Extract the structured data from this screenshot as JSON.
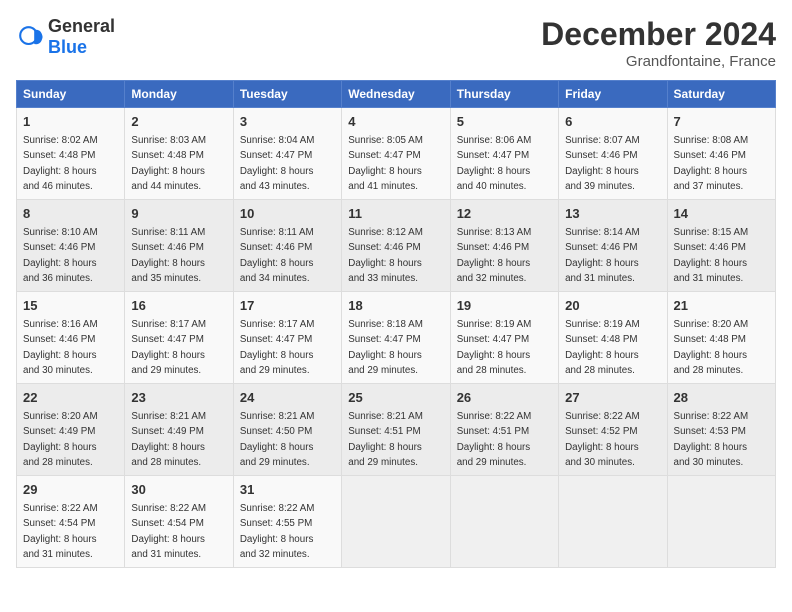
{
  "header": {
    "logo_general": "General",
    "logo_blue": "Blue",
    "month_title": "December 2024",
    "location": "Grandfontaine, France"
  },
  "days_of_week": [
    "Sunday",
    "Monday",
    "Tuesday",
    "Wednesday",
    "Thursday",
    "Friday",
    "Saturday"
  ],
  "weeks": [
    [
      {
        "day": "1",
        "sunrise": "8:02 AM",
        "sunset": "4:48 PM",
        "daylight": "8 hours and 46 minutes."
      },
      {
        "day": "2",
        "sunrise": "8:03 AM",
        "sunset": "4:48 PM",
        "daylight": "8 hours and 44 minutes."
      },
      {
        "day": "3",
        "sunrise": "8:04 AM",
        "sunset": "4:47 PM",
        "daylight": "8 hours and 43 minutes."
      },
      {
        "day": "4",
        "sunrise": "8:05 AM",
        "sunset": "4:47 PM",
        "daylight": "8 hours and 41 minutes."
      },
      {
        "day": "5",
        "sunrise": "8:06 AM",
        "sunset": "4:47 PM",
        "daylight": "8 hours and 40 minutes."
      },
      {
        "day": "6",
        "sunrise": "8:07 AM",
        "sunset": "4:46 PM",
        "daylight": "8 hours and 39 minutes."
      },
      {
        "day": "7",
        "sunrise": "8:08 AM",
        "sunset": "4:46 PM",
        "daylight": "8 hours and 37 minutes."
      }
    ],
    [
      {
        "day": "8",
        "sunrise": "8:10 AM",
        "sunset": "4:46 PM",
        "daylight": "8 hours and 36 minutes."
      },
      {
        "day": "9",
        "sunrise": "8:11 AM",
        "sunset": "4:46 PM",
        "daylight": "8 hours and 35 minutes."
      },
      {
        "day": "10",
        "sunrise": "8:11 AM",
        "sunset": "4:46 PM",
        "daylight": "8 hours and 34 minutes."
      },
      {
        "day": "11",
        "sunrise": "8:12 AM",
        "sunset": "4:46 PM",
        "daylight": "8 hours and 33 minutes."
      },
      {
        "day": "12",
        "sunrise": "8:13 AM",
        "sunset": "4:46 PM",
        "daylight": "8 hours and 32 minutes."
      },
      {
        "day": "13",
        "sunrise": "8:14 AM",
        "sunset": "4:46 PM",
        "daylight": "8 hours and 31 minutes."
      },
      {
        "day": "14",
        "sunrise": "8:15 AM",
        "sunset": "4:46 PM",
        "daylight": "8 hours and 31 minutes."
      }
    ],
    [
      {
        "day": "15",
        "sunrise": "8:16 AM",
        "sunset": "4:46 PM",
        "daylight": "8 hours and 30 minutes."
      },
      {
        "day": "16",
        "sunrise": "8:17 AM",
        "sunset": "4:47 PM",
        "daylight": "8 hours and 29 minutes."
      },
      {
        "day": "17",
        "sunrise": "8:17 AM",
        "sunset": "4:47 PM",
        "daylight": "8 hours and 29 minutes."
      },
      {
        "day": "18",
        "sunrise": "8:18 AM",
        "sunset": "4:47 PM",
        "daylight": "8 hours and 29 minutes."
      },
      {
        "day": "19",
        "sunrise": "8:19 AM",
        "sunset": "4:47 PM",
        "daylight": "8 hours and 28 minutes."
      },
      {
        "day": "20",
        "sunrise": "8:19 AM",
        "sunset": "4:48 PM",
        "daylight": "8 hours and 28 minutes."
      },
      {
        "day": "21",
        "sunrise": "8:20 AM",
        "sunset": "4:48 PM",
        "daylight": "8 hours and 28 minutes."
      }
    ],
    [
      {
        "day": "22",
        "sunrise": "8:20 AM",
        "sunset": "4:49 PM",
        "daylight": "8 hours and 28 minutes."
      },
      {
        "day": "23",
        "sunrise": "8:21 AM",
        "sunset": "4:49 PM",
        "daylight": "8 hours and 28 minutes."
      },
      {
        "day": "24",
        "sunrise": "8:21 AM",
        "sunset": "4:50 PM",
        "daylight": "8 hours and 29 minutes."
      },
      {
        "day": "25",
        "sunrise": "8:21 AM",
        "sunset": "4:51 PM",
        "daylight": "8 hours and 29 minutes."
      },
      {
        "day": "26",
        "sunrise": "8:22 AM",
        "sunset": "4:51 PM",
        "daylight": "8 hours and 29 minutes."
      },
      {
        "day": "27",
        "sunrise": "8:22 AM",
        "sunset": "4:52 PM",
        "daylight": "8 hours and 30 minutes."
      },
      {
        "day": "28",
        "sunrise": "8:22 AM",
        "sunset": "4:53 PM",
        "daylight": "8 hours and 30 minutes."
      }
    ],
    [
      {
        "day": "29",
        "sunrise": "8:22 AM",
        "sunset": "4:54 PM",
        "daylight": "8 hours and 31 minutes."
      },
      {
        "day": "30",
        "sunrise": "8:22 AM",
        "sunset": "4:54 PM",
        "daylight": "8 hours and 31 minutes."
      },
      {
        "day": "31",
        "sunrise": "8:22 AM",
        "sunset": "4:55 PM",
        "daylight": "8 hours and 32 minutes."
      },
      null,
      null,
      null,
      null
    ]
  ]
}
